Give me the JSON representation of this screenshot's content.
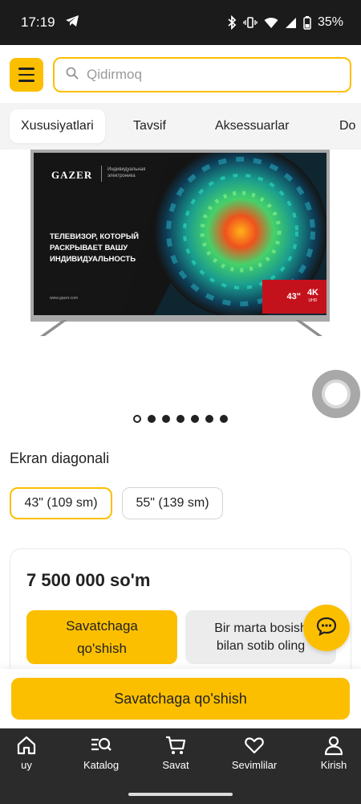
{
  "status_bar": {
    "time": "17:19",
    "battery": "35%"
  },
  "header": {
    "search_placeholder": "Qidirmoq"
  },
  "tabs": [
    {
      "label": "Xususiyatlari",
      "active": true
    },
    {
      "label": "Tavsif",
      "active": false
    },
    {
      "label": "Aksessuarlar",
      "active": false
    },
    {
      "label": "Do",
      "active": false
    }
  ],
  "product_image": {
    "brand": "GAZER",
    "brand_tagline": "Индивидуальная электроника",
    "headline": "ТЕЛЕВИЗОР, КОТОРЫЙ РАСКРЫВАЕТ ВАШУ ИНДИВИДУАЛЬНОСТЬ",
    "url": "www.gazer.com",
    "size_badge": "43\"",
    "resolution_badge": "4K",
    "resolution_sub": "UHD",
    "carousel": {
      "total": 7,
      "active_index": 0
    }
  },
  "diagonal": {
    "title": "Ekran diagonali",
    "options": [
      {
        "label": "43\" (109 sm)",
        "selected": true
      },
      {
        "label": "55\" (139 sm)",
        "selected": false
      }
    ]
  },
  "price_card": {
    "price": "7 500 000 so'm",
    "add_to_cart_line1": "Savatchaga",
    "add_to_cart_line2": "qo'shish",
    "one_click_line1": "Bir marta bosish",
    "one_click_line2": "bilan sotib oling"
  },
  "bottom_action": {
    "add_to_cart": "Savatchaga qo'shish"
  },
  "bottom_nav": [
    {
      "label": "uy",
      "icon": "home-icon"
    },
    {
      "label": "Katalog",
      "icon": "catalog-search-icon"
    },
    {
      "label": "Savat",
      "icon": "cart-icon"
    },
    {
      "label": "Sevimlilar",
      "icon": "heart-icon"
    },
    {
      "label": "Kirish",
      "icon": "user-icon"
    }
  ],
  "colors": {
    "accent": "#fcbf00",
    "nav_bg": "#2b2b2b",
    "status_bg": "#1b1b1b",
    "badge_red": "#c4121d"
  }
}
